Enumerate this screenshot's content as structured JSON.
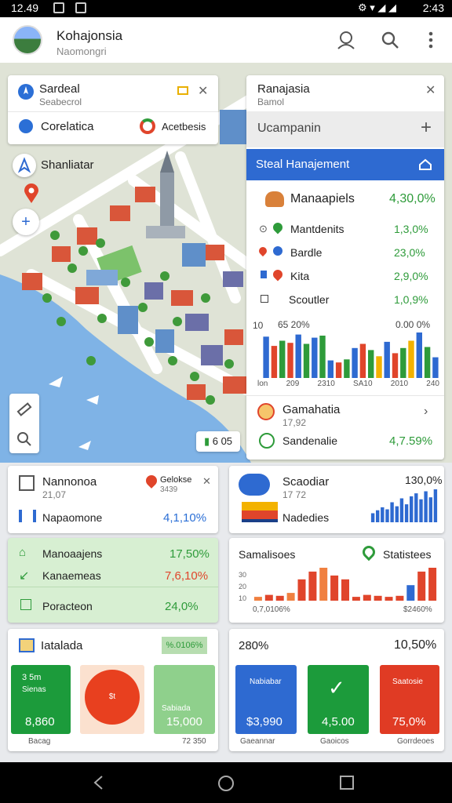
{
  "status": {
    "time_left": "12.49",
    "time_right": "2:43"
  },
  "appbar": {
    "title": "Kohajonsia",
    "subtitle": "Naomongri"
  },
  "map": {
    "search_card": {
      "title": "Sardeal",
      "subtitle": "Seabecrol",
      "row_label": "Corelatica",
      "row_right": "Acetbesis"
    },
    "float_label": "Shanliatar",
    "price_badge": "6 05"
  },
  "panel": {
    "title": "Ranajasia",
    "subtitle": "Bamol",
    "section": "Ucampanin",
    "header_bar": "Steal Hanajement",
    "main_row": {
      "label": "Manaapiels",
      "value": "4,30,0%"
    },
    "rows": [
      {
        "label": "Mantdenits",
        "value": "1,3,0%"
      },
      {
        "label": "Bardle",
        "value": "23,0%"
      },
      {
        "label": "Kita",
        "value": "2,9,0%"
      },
      {
        "label": "Scoutler",
        "value": "1,0,9%"
      }
    ],
    "chart_left_label": "65 20%",
    "chart_right_label": "0.00 0%",
    "chart_y_label": "10",
    "x_ticks": [
      "lon",
      "209",
      "2310",
      "SA10",
      "2010",
      "240"
    ],
    "footer1": {
      "title": "Gamahatia",
      "sub": "17,92"
    },
    "footer2": {
      "label": "Sandenalie",
      "value": "4,7.59%"
    }
  },
  "cards": {
    "c1": {
      "title": "Nannonoa",
      "sub": "21,07",
      "right_title": "Gelokse",
      "right_sub": "3439",
      "row_label": "Napaomone",
      "row_value": "4,1,10%"
    },
    "c2": {
      "title": "Scaodiar",
      "sub": "17 72",
      "value": "130,0%",
      "row_label": "Nadedies"
    },
    "c3": {
      "rows": [
        {
          "label": "Manoaajens",
          "value": "17,50%"
        },
        {
          "label": "Kanaemeas",
          "value": "7,6,10%"
        },
        {
          "label": "Poracteon",
          "value": "24,0%"
        }
      ]
    },
    "c4": {
      "title": "Samalisoes",
      "right": "Statistees",
      "y_ticks": [
        "30",
        "20",
        "10"
      ],
      "left_foot": "0,7,0106%",
      "right_foot": "$2460%"
    },
    "c5": {
      "title": "Iatalada",
      "badge": "%.0106%",
      "tiles": [
        {
          "top": "3 5m",
          "mid": "Sienas",
          "value": "8,860",
          "foot": "Bacag"
        },
        {
          "top": "",
          "mid": "$t",
          "value": "",
          "foot": ""
        },
        {
          "top": "",
          "mid": "Sabiada",
          "value": "15,000",
          "foot": "72 350"
        }
      ]
    },
    "c6": {
      "left": "280%",
      "right": "10,50%",
      "tiles": [
        {
          "top": "Nabiabar",
          "value": "$3,990",
          "foot": "Gaeannar"
        },
        {
          "top": "",
          "value": "4,5.00",
          "foot": "Gaoicos"
        },
        {
          "top": "Saatosie",
          "value": "75,0%",
          "foot": "Gorrdeoes"
        }
      ]
    }
  },
  "chart_data": [
    {
      "type": "bar",
      "values": [
        80,
        62,
        72,
        68,
        84,
        66,
        78,
        82,
        34,
        30,
        36,
        58,
        66,
        54,
        42,
        70,
        48,
        58,
        72,
        88,
        60,
        40
      ],
      "colors": [
        "#2e6ad1",
        "#e0452b",
        "#2e9b3a",
        "#e0452b",
        "#2e6ad1",
        "#2e9b3a",
        "#2e6ad1",
        "#2e9b3a",
        "#2e6ad1",
        "#e0452b",
        "#2e9b3a",
        "#2e6ad1",
        "#e0452b",
        "#2e9b3a",
        "#f3b200",
        "#2e6ad1",
        "#e0452b",
        "#2e9b3a",
        "#f3b200",
        "#2e6ad1",
        "#2e9b3a",
        "#2e6ad1"
      ]
    },
    {
      "type": "bar",
      "values": [
        18,
        24,
        30,
        26,
        40,
        32,
        48,
        36,
        52,
        58,
        46,
        62,
        50,
        66
      ]
    },
    {
      "type": "bar",
      "values": [
        4,
        6,
        5,
        8,
        22,
        30,
        34,
        26,
        22,
        4,
        6,
        5,
        4,
        5,
        16,
        30,
        34
      ]
    }
  ]
}
